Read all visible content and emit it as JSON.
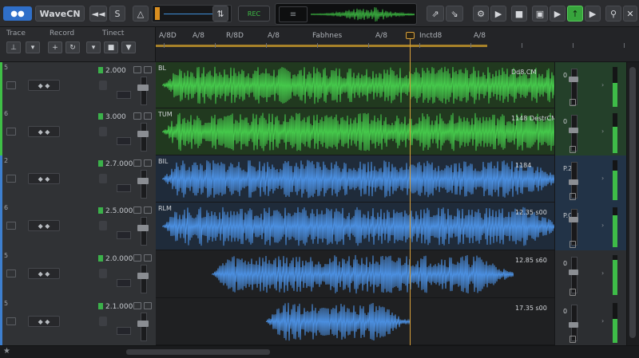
{
  "toolbar": {
    "title": "WaveCN",
    "s_label": "S",
    "record_label": "REC",
    "lcd_text": "≡",
    "accent": "#37a43c"
  },
  "header": {
    "col1": "Trace",
    "col2": "Record",
    "col3": "Tinect"
  },
  "ruler": {
    "marks": [
      "A/8D",
      "A/8",
      "R/8D",
      "A/8",
      "Fabhnes",
      "A/8",
      "Inctd8",
      "A/8"
    ]
  },
  "tracks": [
    {
      "num": "5",
      "name": "2.000",
      "color": "#3fbf46",
      "lamp": true,
      "pan": "◆ ◆",
      "region_label": "BL",
      "region_right": "Dd8.CM",
      "mixer_label": "0"
    },
    {
      "num": "6",
      "name": "3.000",
      "color": "#3fbf46",
      "lamp": true,
      "pan": "◆ ◆",
      "region_label": "TUM",
      "region_right": "1148 DestrCM",
      "mixer_label": "0"
    },
    {
      "num": "2",
      "name": "2.7.000",
      "color": "#3d7fcf",
      "lamp": true,
      "pan": "◆ ◆",
      "region_label": "BIL",
      "region_right": "1184",
      "mixer_label": "P.27"
    },
    {
      "num": "6",
      "name": "2.5.000",
      "color": "#3d7fcf",
      "lamp": true,
      "pan": "◆ ◆",
      "region_label": "RLM",
      "region_right": "12.35 s00",
      "mixer_label": "P.OM"
    },
    {
      "num": "5",
      "name": "2.0.000",
      "color": "#3d7fcf",
      "lamp": true,
      "pan": "◆ ◆",
      "region_label": "",
      "region_right": "12.85 s60",
      "mixer_label": "0"
    },
    {
      "num": "5",
      "name": "2.1.000",
      "color": "#3d7fcf",
      "lamp": true,
      "pan": "◆ ◆",
      "region_label": "",
      "region_right": "17.35 s00",
      "mixer_label": "0"
    }
  ],
  "status": {
    "left": "★"
  }
}
